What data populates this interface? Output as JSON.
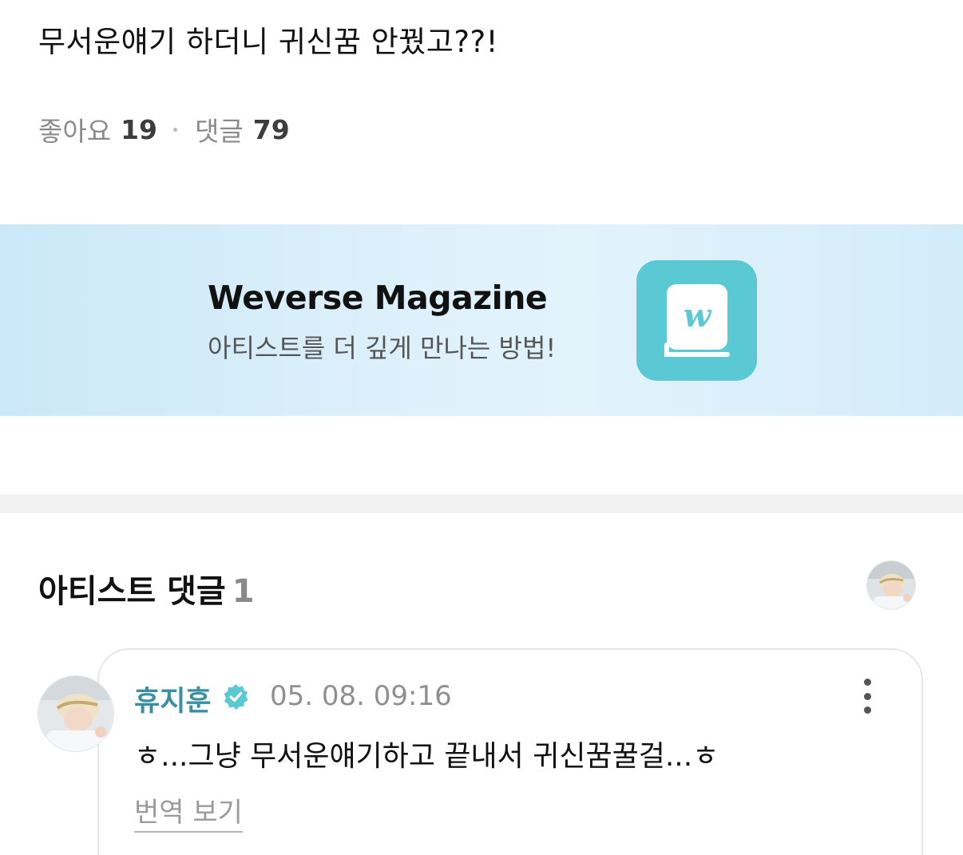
{
  "post": {
    "text": "무서운얘기 하더니 귀신꿈 안꿨고??!",
    "likes_label": "좋아요",
    "likes_count": "19",
    "comments_label": "댓글",
    "comments_count": "79"
  },
  "banner": {
    "title": "Weverse Magazine",
    "subtitle": "아티스트를 더 깊게 만나는 방법!",
    "app_icon": "weverse-magazine-book-icon",
    "background_color": "#d6eefa",
    "app_icon_color": "#5bc9d4"
  },
  "artist_comments": {
    "title": "아티스트 댓글",
    "count": "1",
    "comment": {
      "author": "휴지훈",
      "verified_icon": "verified-badge-icon",
      "date": "05. 08. 09:16",
      "text": "ㅎ...그냥 무서운얘기하고 끝내서 귀신꿈꿀걸...ㅎ",
      "translate_label": "번역 보기",
      "more_icon": "more-vertical-icon"
    }
  },
  "colors": {
    "author": "#3b8fa3",
    "verified": "#5bc9d4",
    "muted": "#8a8a8a"
  }
}
